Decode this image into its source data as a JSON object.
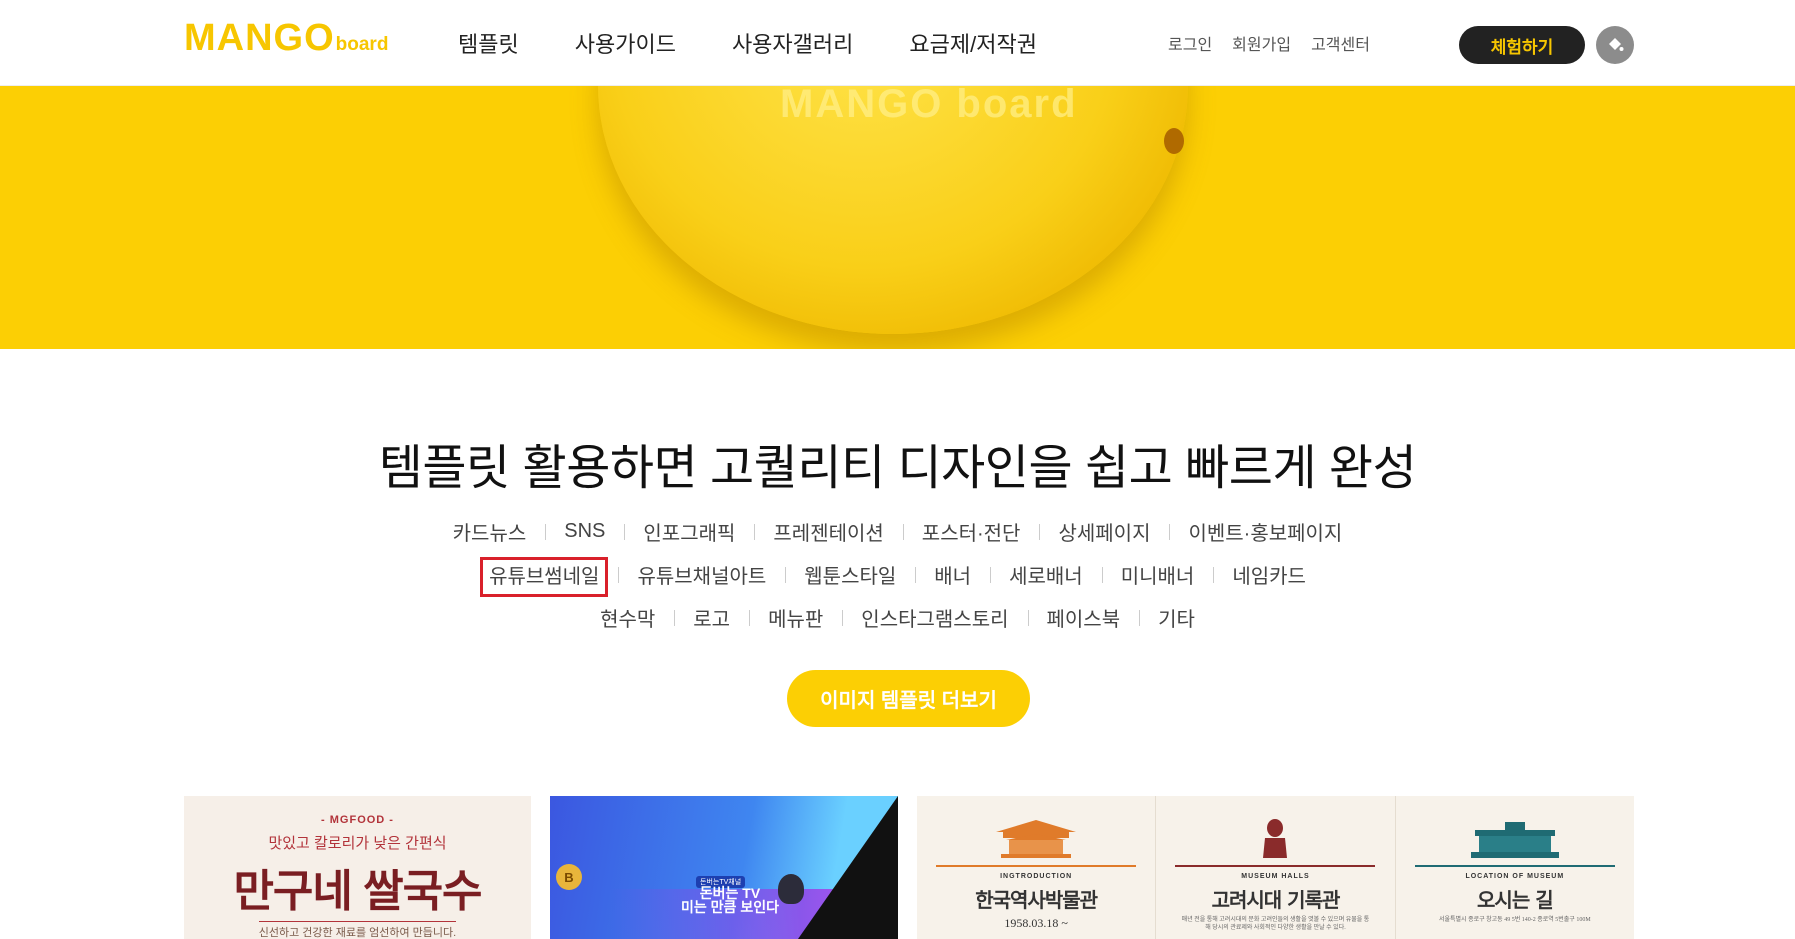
{
  "header": {
    "logo_main": "MANGO",
    "logo_sub": "board",
    "nav": [
      "템플릿",
      "사용가이드",
      "사용자갤러리",
      "요금제/저작권"
    ],
    "util": [
      "로그인",
      "회원가입",
      "고객센터"
    ],
    "trial_button": "체험하기"
  },
  "banner": {
    "mango_text": "MANGO board",
    "bg_color": "#fccf04"
  },
  "section": {
    "title": "템플릿 활용하면 고퀄리티 디자인을 쉽고 빠르게 완성",
    "categories_row1": [
      "카드뉴스",
      "SNS",
      "인포그래픽",
      "프레젠테이션",
      "포스터·전단",
      "상세페이지",
      "이벤트·홍보페이지"
    ],
    "categories_row2": [
      "유튜브썸네일",
      "유튜브채널아트",
      "웹툰스타일",
      "배너",
      "세로배너",
      "미니배너",
      "네임카드"
    ],
    "categories_row3": [
      "현수막",
      "로고",
      "메뉴판",
      "인스타그램스토리",
      "페이스북",
      "기타"
    ],
    "highlighted_category": "유튜브썸네일",
    "more_button": "이미지 템플릿 더보기"
  },
  "thumbnails": {
    "t1": {
      "tag": "- MGFOOD -",
      "sub": "맛있고 칼로리가 낮은 간편식",
      "main": "만구네 쌀국수",
      "desc": "신선하고 건강한 재료를 엄선하여 만듭니다."
    },
    "t2": {
      "coin": "B",
      "badge": "돈버는TV채널",
      "line1": "돈버는 TV",
      "line2": "미는 만큼 보인다"
    },
    "t3": [
      {
        "label": "INGTRODUCTION",
        "name": "한국역사박물관",
        "info": "1958.03.18 ~",
        "color": "#e07b2a"
      },
      {
        "label": "MUSEUM HALLS",
        "name": "고려시대 기록관",
        "info": "매년 전을 통해 고려시대의 문화 고려인들의 생활을 엿볼 수 있으며 유물을 통해 당시의 관료제와 사회적인 다양한 생활을 만날 수 있다.",
        "color": "#8a2b2b"
      },
      {
        "label": "LOCATION OF MUSEUM",
        "name": "오시는 길",
        "info": "서울특별시 종로구 창고동 49 5번 140-2 종로역 5번출구 100M",
        "color": "#1f6b73"
      }
    ]
  }
}
